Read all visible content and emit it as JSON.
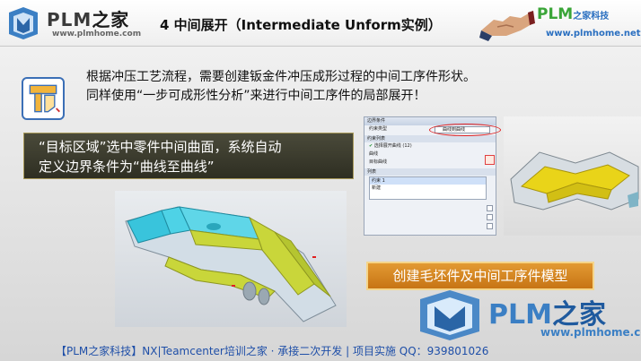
{
  "header": {
    "logo_left": {
      "name_en": "PLM",
      "name_cn": "之家",
      "url": "www.plmhome.com"
    },
    "title": "4 中间展开（Intermediate Unform实例）",
    "logo_right": {
      "name_en": "PLM",
      "name_cn": "之家科技",
      "url": "www.plmhome.net"
    }
  },
  "intro": {
    "line1": "根据冲压工艺流程，需要创建钣金件冲压成形过程的中间工序件形状。",
    "line2": "同样使用“一步可成形性分析”来进行中间工序件的局部展开！"
  },
  "callout_dark": {
    "line1": "“目标区域”选中零件中间曲面，系统自动",
    "line2": "定义边界条件为“曲线至曲线”"
  },
  "callout_orange": "创建毛坯件及中间工序件模型",
  "dialog": {
    "title": "边界条件",
    "constraint_type_label": "约束类型",
    "constraint_type_value": "曲线到曲线",
    "select_curve_label": "选择展开曲线 (12)",
    "row_curve": "曲线",
    "row_target": "目标曲线",
    "section_constraint_list": "约束列表",
    "section_list": "列表",
    "list_items": [
      "约束 1",
      "新建"
    ]
  },
  "watermark": {
    "name_en": "PLM",
    "name_cn": "之家",
    "url": "www.plmhome.com"
  },
  "footer": "【PLM之家科技】NX|Teamcenter培训之家 · 承接二次开发 | 项目实施 QQ：939801026",
  "colors": {
    "accent_blue": "#3b7fc4",
    "accent_green": "#3aa538",
    "callout_orange": "#d88425",
    "callout_dark": "#3a3a2c"
  }
}
